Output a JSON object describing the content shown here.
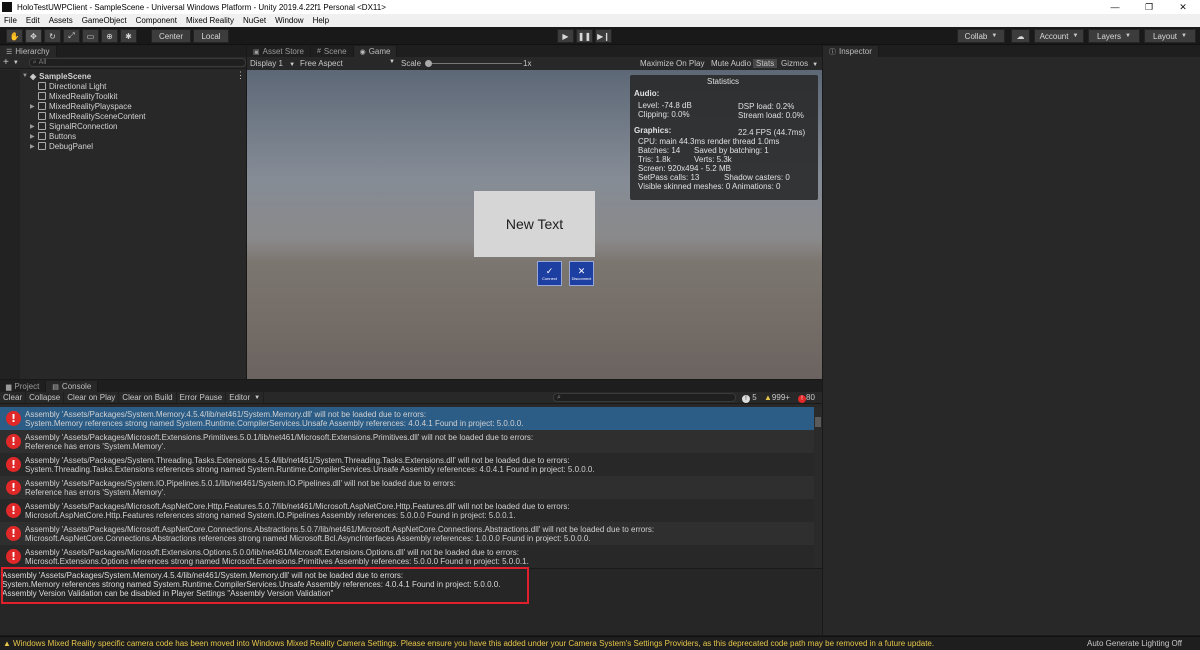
{
  "window": {
    "title": "HoloTestUWPClient - SampleScene - Universal Windows Platform - Unity 2019.4.22f1 Personal <DX11>"
  },
  "menu": [
    "File",
    "Edit",
    "Assets",
    "GameObject",
    "Component",
    "Mixed Reality",
    "NuGet",
    "Window",
    "Help"
  ],
  "toolbar": {
    "pivot": "Center",
    "space": "Local",
    "collab": "Collab",
    "account": "Account",
    "layers": "Layers",
    "layout": "Layout"
  },
  "hierarchy": {
    "tab": "Hierarchy",
    "search_placeholder": "All",
    "scene": "SampleScene",
    "items": [
      "Directional Light",
      "MixedRealityToolkit",
      "MixedRealityPlayspace",
      "MixedRealitySceneContent",
      "SignalRConnection",
      "Buttons",
      "DebugPanel"
    ]
  },
  "game": {
    "tabs": [
      "Asset Store",
      "Scene",
      "Game"
    ],
    "display": "Display 1",
    "aspect": "Free Aspect",
    "scale_label": "Scale",
    "scale_value": "1x",
    "maximize": "Maximize On Play",
    "mute": "Mute Audio",
    "stats": "Stats",
    "gizmos": "Gizmos",
    "new_text": "New Text",
    "btn_connect": "Connect",
    "btn_disconnect": "Disconnect"
  },
  "statistics": {
    "title": "Statistics",
    "audio_header": "Audio:",
    "level": "Level: -74.8 dB",
    "clipping": "Clipping: 0.0%",
    "dsp": "DSP load: 0.2%",
    "stream": "Stream load: 0.0%",
    "graphics_header": "Graphics:",
    "fps": "22.4 FPS (44.7ms)",
    "cpu": "CPU: main 44.3ms  render thread 1.0ms",
    "batches": "Batches: 14",
    "saved": "Saved by batching: 1",
    "tris": "Tris: 1.8k",
    "verts": "Verts: 5.3k",
    "screen": "Screen: 920x494 - 5.2 MB",
    "setpass": "SetPass calls: 13",
    "shadow": "Shadow casters: 0",
    "skinned": "Visible skinned meshes: 0",
    "animations": "Animations: 0"
  },
  "inspector": {
    "tab": "Inspector"
  },
  "console": {
    "tabs": [
      "Project",
      "Console"
    ],
    "buttons": [
      "Clear",
      "Collapse",
      "Clear on Play",
      "Clear on Build",
      "Error Pause",
      "Editor"
    ],
    "count_info": "5",
    "count_warn": "999+",
    "count_error": "80",
    "rows": [
      [
        "Assembly 'Assets/Packages/System.Memory.4.5.4/lib/net461/System.Memory.dll' will not be loaded due to errors:",
        "System.Memory references strong named System.Runtime.CompilerServices.Unsafe Assembly references: 4.0.4.1 Found in project: 5.0.0.0."
      ],
      [
        "Assembly 'Assets/Packages/Microsoft.Extensions.Primitives.5.0.1/lib/net461/Microsoft.Extensions.Primitives.dll' will not be loaded due to errors:",
        "Reference has errors 'System.Memory'."
      ],
      [
        "Assembly 'Assets/Packages/System.Threading.Tasks.Extensions.4.5.4/lib/net461/System.Threading.Tasks.Extensions.dll' will not be loaded due to errors:",
        "System.Threading.Tasks.Extensions references strong named System.Runtime.CompilerServices.Unsafe Assembly references: 4.0.4.1 Found in project: 5.0.0.0."
      ],
      [
        "Assembly 'Assets/Packages/System.IO.Pipelines.5.0.1/lib/net461/System.IO.Pipelines.dll' will not be loaded due to errors:",
        "Reference has errors 'System.Memory'."
      ],
      [
        "Assembly 'Assets/Packages/Microsoft.AspNetCore.Http.Features.5.0.7/lib/net461/Microsoft.AspNetCore.Http.Features.dll' will not be loaded due to errors:",
        "Microsoft.AspNetCore.Http.Features references strong named System.IO.Pipelines Assembly references: 5.0.0.0 Found in project: 5.0.0.1."
      ],
      [
        "Assembly 'Assets/Packages/Microsoft.AspNetCore.Connections.Abstractions.5.0.7/lib/net461/Microsoft.AspNetCore.Connections.Abstractions.dll' will not be loaded due to errors:",
        "Microsoft.AspNetCore.Connections.Abstractions references strong named Microsoft.Bcl.AsyncInterfaces Assembly references: 1.0.0.0 Found in project: 5.0.0.0."
      ],
      [
        "Assembly 'Assets/Packages/Microsoft.Extensions.Options.5.0.0/lib/net461/Microsoft.Extensions.Options.dll' will not be loaded due to errors:",
        "Microsoft.Extensions.Options references strong named Microsoft.Extensions.Primitives Assembly references: 5.0.0.0 Found in project: 5.0.0.1."
      ]
    ],
    "detail": [
      "Assembly 'Assets/Packages/System.Memory.4.5.4/lib/net461/System.Memory.dll' will not be loaded due to errors:",
      "System.Memory references strong named System.Runtime.CompilerServices.Unsafe Assembly references: 4.0.4.1 Found in project: 5.0.0.0.",
      "Assembly Version Validation can be disabled in Player Settings \"Assembly Version Validation\""
    ]
  },
  "status": {
    "message": "Windows Mixed Reality specific camera code has been moved into Windows Mixed Reality Camera Settings. Please ensure you have this added under your Camera System's Settings Providers, as this deprecated code path may be removed in a future update.",
    "right": "Auto Generate Lighting Off"
  },
  "colors": {
    "error": "#e02828",
    "selection": "#2c5d87",
    "highlight_box": "#e0202a",
    "warning_text": "#e6c64a",
    "button_blue": "#1d3fa2"
  }
}
